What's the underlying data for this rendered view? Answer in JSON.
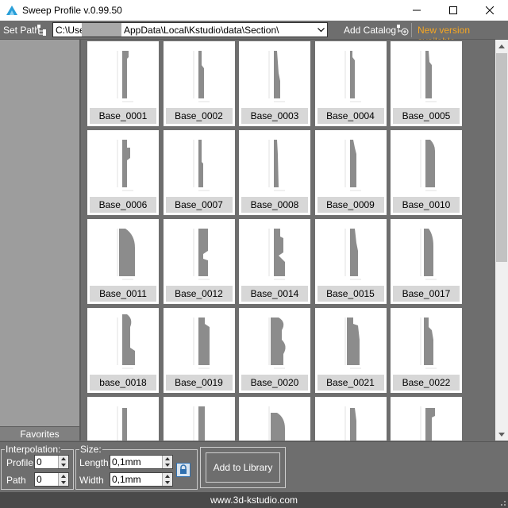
{
  "window": {
    "title": "Sweep Profile v.0.99.50"
  },
  "toolbar": {
    "set_path_label": "Set Path",
    "path_value_start": "C:\\Use",
    "path_value_end": "AppData\\Local\\Kstudio\\data\\Section\\",
    "add_catalog_label": "Add Catalog",
    "new_version_label": "New version available",
    "new_version_color": "#f5a623"
  },
  "sidebar": {
    "favorites_label": "Favorites"
  },
  "grid": {
    "items": [
      {
        "label": "Base_0001"
      },
      {
        "label": "Base_0002"
      },
      {
        "label": "Base_0003"
      },
      {
        "label": "Base_0004"
      },
      {
        "label": "Base_0005"
      },
      {
        "label": "Base_0006"
      },
      {
        "label": "Base_0007"
      },
      {
        "label": "Base_0008"
      },
      {
        "label": "Base_0009"
      },
      {
        "label": "Base_0010"
      },
      {
        "label": "Base_0011"
      },
      {
        "label": "Base_0012"
      },
      {
        "label": "Base_0014"
      },
      {
        "label": "Base_0015"
      },
      {
        "label": "Base_0017"
      },
      {
        "label": "base_0018"
      },
      {
        "label": "Base_0019"
      },
      {
        "label": "Base_0020"
      },
      {
        "label": "Base_0021"
      },
      {
        "label": "Base_0022"
      },
      {
        "label": ""
      },
      {
        "label": ""
      },
      {
        "label": ""
      },
      {
        "label": ""
      },
      {
        "label": ""
      }
    ]
  },
  "interpolation": {
    "legend": "Interpolation:",
    "profile_label": "Profile",
    "profile_value": "0",
    "path_label": "Path",
    "path_value": "0"
  },
  "size": {
    "legend": "Size:",
    "length_label": "Length:",
    "length_value": "0,1mm",
    "width_label": "Width",
    "width_value": "0,1mm"
  },
  "actions": {
    "add_to_library_label": "Add to Library"
  },
  "footer": {
    "url": "www.3d-kstudio.com"
  }
}
